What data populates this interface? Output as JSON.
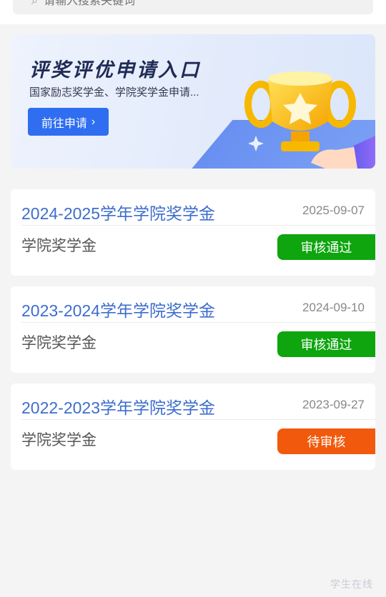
{
  "search": {
    "placeholder": "请输入搜索关键词"
  },
  "banner": {
    "title": "评奖评优申请入口",
    "subtitle": "国家励志奖学金、学院奖学金申请...",
    "button_label": "前往申请",
    "button_color": "#2f6ef0"
  },
  "applications": [
    {
      "name": "2024-2025学年学院奖学金",
      "date": "2025-09-07",
      "type": "学院奖学金",
      "status": "审核通过",
      "status_color": "#0ea50e"
    },
    {
      "name": "2023-2024学年学院奖学金",
      "date": "2024-09-10",
      "type": "学院奖学金",
      "status": "审核通过",
      "status_color": "#0ea50e"
    },
    {
      "name": "2022-2023学年学院奖学金",
      "date": "2023-09-27",
      "type": "学院奖学金",
      "status": "待审核",
      "status_color": "#f15a0c"
    }
  ],
  "watermark": "学生在线"
}
